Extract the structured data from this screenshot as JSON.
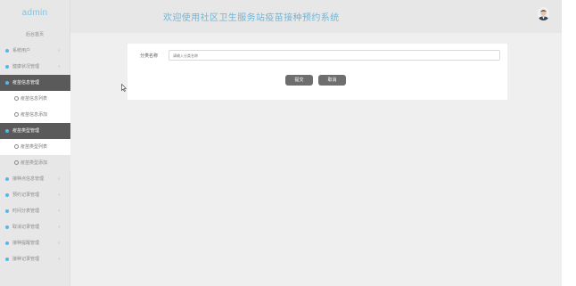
{
  "sidebar": {
    "brand": "admin",
    "home": "后台首页",
    "items": [
      {
        "label": "系统用户",
        "chevron": "‹",
        "type": "item"
      },
      {
        "label": "健康状况管理",
        "chevron": "‹",
        "type": "item"
      },
      {
        "label": "疫苗信息管理",
        "chevron": "",
        "type": "active"
      },
      {
        "label": "疫苗信息列表",
        "type": "sub"
      },
      {
        "label": "疫苗信息添加",
        "type": "sub"
      },
      {
        "label": "疫苗类型管理",
        "chevron": "",
        "type": "active"
      },
      {
        "label": "疫苗类型列表",
        "type": "sub"
      },
      {
        "label": "疫苗类型添加",
        "type": "subdim"
      },
      {
        "label": "接种点信息管理",
        "chevron": "‹",
        "type": "item"
      },
      {
        "label": "预约记录管理",
        "chevron": "‹",
        "type": "item"
      },
      {
        "label": "时间分表管理",
        "chevron": "‹",
        "type": "item"
      },
      {
        "label": "取消记录管理",
        "chevron": "‹",
        "type": "item"
      },
      {
        "label": "接种提醒管理",
        "chevron": "‹",
        "type": "item"
      },
      {
        "label": "接种记录管理",
        "chevron": "‹",
        "type": "item"
      }
    ]
  },
  "header": {
    "title": "欢迎使用社区卫生服务站疫苗接种预约系统"
  },
  "form": {
    "label": "分类名称",
    "placeholder": "请输入分类名称",
    "submit": "提交",
    "cancel": "取消"
  },
  "colors": {
    "accent": "#6fb6d8",
    "active_menu": "#5a5a5a",
    "button": "#6e6e6e"
  }
}
